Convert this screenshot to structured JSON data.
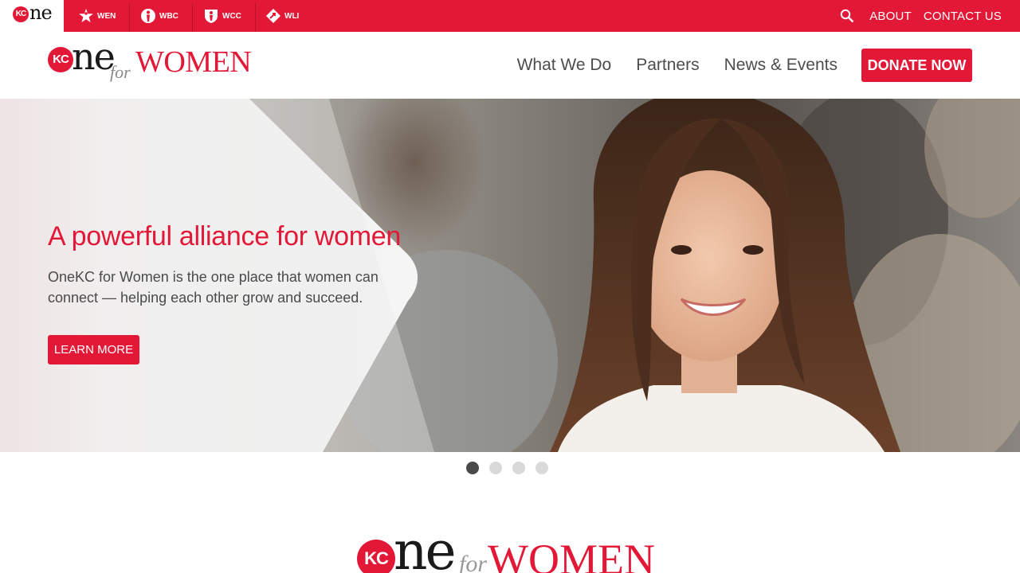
{
  "colors": {
    "brand_red": "#e31837",
    "text_gray": "#4a4a4a",
    "dot_active": "#4a4a4a",
    "dot_inactive": "#d9d9d9"
  },
  "topbar": {
    "home_logo": {
      "kc": "KC",
      "ne": "ne"
    },
    "tabs": [
      {
        "label": "WEN",
        "icon": "star-person-icon"
      },
      {
        "label": "WBC",
        "icon": "person-circle-icon"
      },
      {
        "label": "WCC",
        "icon": "person-shield-icon"
      },
      {
        "label": "WLI",
        "icon": "arrow-diamond-icon"
      }
    ],
    "search_icon": "search-icon",
    "links": {
      "about": "ABOUT",
      "contact": "CONTACT US"
    }
  },
  "header": {
    "logo": {
      "kc": "KC",
      "ne": "ne",
      "for": "for",
      "women": "WOMEN"
    },
    "nav": [
      "What We Do",
      "Partners",
      "News & Events"
    ],
    "donate_label": "DONATE NOW"
  },
  "hero": {
    "title": "A powerful alliance for women",
    "text": "OneKC for Women is the one place that women can connect — helping each other grow and succeed.",
    "button_label": "LEARN MORE"
  },
  "carousel": {
    "slides": 4,
    "active": 1
  },
  "footer_logo": {
    "kc": "KC",
    "ne": "ne",
    "for": "for",
    "women": "WOMEN"
  }
}
